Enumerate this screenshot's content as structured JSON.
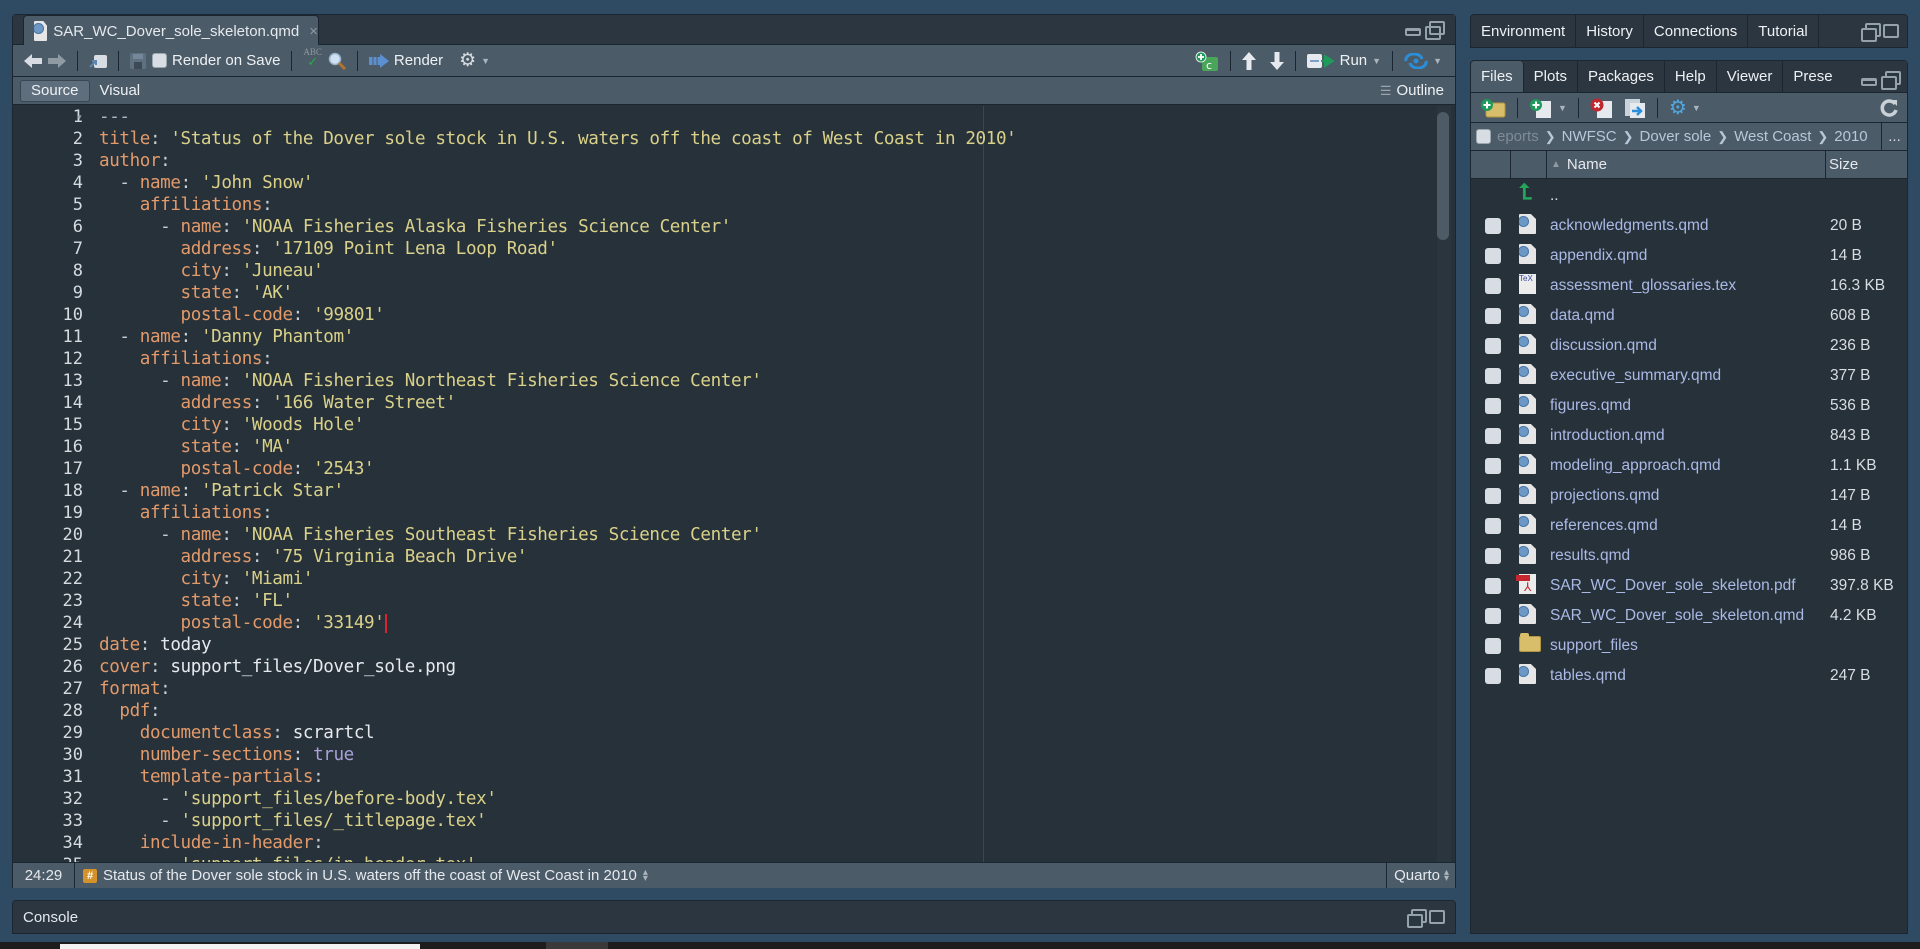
{
  "editor": {
    "tab": {
      "filename": "SAR_WC_Dover_sole_skeleton.qmd",
      "icon": "quarto-file-icon",
      "close": "×"
    },
    "toolbar": {
      "render_on_save_label": "Render on Save",
      "render_on_save_checked": false,
      "spellcheck_label": "ABC",
      "render_label": "Render",
      "run_label": "Run",
      "outline_label": "Outline"
    },
    "modes": {
      "source": "Source",
      "visual": "Visual",
      "active": "Source"
    },
    "code_lines": [
      [
        [
          "d",
          "---"
        ]
      ],
      [
        [
          "k",
          "title"
        ],
        [
          "p",
          ": "
        ],
        [
          "s",
          "'Status of the Dover sole stock in U.S. waters off the coast of West Coast in 2010'"
        ]
      ],
      [
        [
          "k",
          "author"
        ],
        [
          "p",
          ":"
        ]
      ],
      [
        [
          "p",
          "  - "
        ],
        [
          "k",
          "name"
        ],
        [
          "p",
          ": "
        ],
        [
          "s",
          "'John Snow'"
        ]
      ],
      [
        [
          "p",
          "    "
        ],
        [
          "k",
          "affiliations"
        ],
        [
          "p",
          ":"
        ]
      ],
      [
        [
          "p",
          "      - "
        ],
        [
          "k",
          "name"
        ],
        [
          "p",
          ": "
        ],
        [
          "s",
          "'NOAA Fisheries Alaska Fisheries Science Center'"
        ]
      ],
      [
        [
          "p",
          "        "
        ],
        [
          "k",
          "address"
        ],
        [
          "p",
          ": "
        ],
        [
          "s",
          "'17109 Point Lena Loop Road'"
        ]
      ],
      [
        [
          "p",
          "        "
        ],
        [
          "k",
          "city"
        ],
        [
          "p",
          ": "
        ],
        [
          "s",
          "'Juneau'"
        ]
      ],
      [
        [
          "p",
          "        "
        ],
        [
          "k",
          "state"
        ],
        [
          "p",
          ": "
        ],
        [
          "s",
          "'AK'"
        ]
      ],
      [
        [
          "p",
          "        "
        ],
        [
          "k",
          "postal-code"
        ],
        [
          "p",
          ": "
        ],
        [
          "s",
          "'99801'"
        ]
      ],
      [
        [
          "p",
          "  - "
        ],
        [
          "k",
          "name"
        ],
        [
          "p",
          ": "
        ],
        [
          "s",
          "'Danny Phantom'"
        ]
      ],
      [
        [
          "p",
          "    "
        ],
        [
          "k",
          "affiliations"
        ],
        [
          "p",
          ":"
        ]
      ],
      [
        [
          "p",
          "      - "
        ],
        [
          "k",
          "name"
        ],
        [
          "p",
          ": "
        ],
        [
          "s",
          "'NOAA Fisheries Northeast Fisheries Science Center'"
        ]
      ],
      [
        [
          "p",
          "        "
        ],
        [
          "k",
          "address"
        ],
        [
          "p",
          ": "
        ],
        [
          "s",
          "'166 Water Street'"
        ]
      ],
      [
        [
          "p",
          "        "
        ],
        [
          "k",
          "city"
        ],
        [
          "p",
          ": "
        ],
        [
          "s",
          "'Woods Hole'"
        ]
      ],
      [
        [
          "p",
          "        "
        ],
        [
          "k",
          "state"
        ],
        [
          "p",
          ": "
        ],
        [
          "s",
          "'MA'"
        ]
      ],
      [
        [
          "p",
          "        "
        ],
        [
          "k",
          "postal-code"
        ],
        [
          "p",
          ": "
        ],
        [
          "s",
          "'2543'"
        ]
      ],
      [
        [
          "p",
          "  - "
        ],
        [
          "k",
          "name"
        ],
        [
          "p",
          ": "
        ],
        [
          "s",
          "'Patrick Star'"
        ]
      ],
      [
        [
          "p",
          "    "
        ],
        [
          "k",
          "affiliations"
        ],
        [
          "p",
          ":"
        ]
      ],
      [
        [
          "p",
          "      - "
        ],
        [
          "k",
          "name"
        ],
        [
          "p",
          ": "
        ],
        [
          "s",
          "'NOAA Fisheries Southeast Fisheries Science Center'"
        ]
      ],
      [
        [
          "p",
          "        "
        ],
        [
          "k",
          "address"
        ],
        [
          "p",
          ": "
        ],
        [
          "s",
          "'75 Virginia Beach Drive'"
        ]
      ],
      [
        [
          "p",
          "        "
        ],
        [
          "k",
          "city"
        ],
        [
          "p",
          ": "
        ],
        [
          "s",
          "'Miami'"
        ]
      ],
      [
        [
          "p",
          "        "
        ],
        [
          "k",
          "state"
        ],
        [
          "p",
          ": "
        ],
        [
          "s",
          "'FL'"
        ]
      ],
      [
        [
          "p",
          "        "
        ],
        [
          "k",
          "postal-code"
        ],
        [
          "p",
          ": "
        ],
        [
          "s",
          "'33149'"
        ]
      ],
      [
        [
          "k",
          "date"
        ],
        [
          "p",
          ": "
        ],
        [
          "v",
          "today"
        ]
      ],
      [
        [
          "k",
          "cover"
        ],
        [
          "p",
          ": "
        ],
        [
          "v",
          "support_files/Dover_sole.png"
        ]
      ],
      [
        [
          "k",
          "format"
        ],
        [
          "p",
          ":"
        ]
      ],
      [
        [
          "p",
          "  "
        ],
        [
          "k",
          "pdf"
        ],
        [
          "p",
          ":"
        ]
      ],
      [
        [
          "p",
          "    "
        ],
        [
          "k",
          "documentclass"
        ],
        [
          "p",
          ": "
        ],
        [
          "v",
          "scrartcl"
        ]
      ],
      [
        [
          "p",
          "    "
        ],
        [
          "k",
          "number-sections"
        ],
        [
          "p",
          ": "
        ],
        [
          "b",
          "true"
        ]
      ],
      [
        [
          "p",
          "    "
        ],
        [
          "k",
          "template-partials"
        ],
        [
          "p",
          ":"
        ]
      ],
      [
        [
          "p",
          "      - "
        ],
        [
          "s",
          "'support_files/before-body.tex'"
        ]
      ],
      [
        [
          "p",
          "      - "
        ],
        [
          "s",
          "'support_files/_titlepage.tex'"
        ]
      ],
      [
        [
          "p",
          "    "
        ],
        [
          "k",
          "include-in-header"
        ],
        [
          "p",
          ":"
        ]
      ],
      [
        [
          "p",
          "      - "
        ],
        [
          "s",
          "'support_files/in-header.tex'"
        ]
      ]
    ],
    "cursor_line": 24,
    "status": {
      "position": "24:29",
      "section": "Status of the Dover sole stock in U.S. waters off the coast of West Coast in 2010",
      "language": "Quarto"
    }
  },
  "console": {
    "label": "Console"
  },
  "top_right_pane": {
    "tabs": [
      "Environment",
      "History",
      "Connections",
      "Tutorial"
    ]
  },
  "files_pane": {
    "tabs": [
      "Files",
      "Plots",
      "Packages",
      "Help",
      "Viewer",
      "Prese"
    ],
    "active_tab": "Files",
    "breadcrumb": [
      "eports",
      "NWFSC",
      "Dover sole",
      "West Coast",
      "2010"
    ],
    "breadcrumb_more": "...",
    "columns": {
      "name": "Name",
      "size": "Size"
    },
    "parent_dir": "..",
    "files": [
      {
        "name": "acknowledgments.qmd",
        "size": "20 B",
        "type": "qmd"
      },
      {
        "name": "appendix.qmd",
        "size": "14 B",
        "type": "qmd"
      },
      {
        "name": "assessment_glossaries.tex",
        "size": "16.3 KB",
        "type": "tex"
      },
      {
        "name": "data.qmd",
        "size": "608 B",
        "type": "qmd"
      },
      {
        "name": "discussion.qmd",
        "size": "236 B",
        "type": "qmd"
      },
      {
        "name": "executive_summary.qmd",
        "size": "377 B",
        "type": "qmd"
      },
      {
        "name": "figures.qmd",
        "size": "536 B",
        "type": "qmd"
      },
      {
        "name": "introduction.qmd",
        "size": "843 B",
        "type": "qmd"
      },
      {
        "name": "modeling_approach.qmd",
        "size": "1.1 KB",
        "type": "qmd"
      },
      {
        "name": "projections.qmd",
        "size": "147 B",
        "type": "qmd"
      },
      {
        "name": "references.qmd",
        "size": "14 B",
        "type": "qmd"
      },
      {
        "name": "results.qmd",
        "size": "986 B",
        "type": "qmd"
      },
      {
        "name": "SAR_WC_Dover_sole_skeleton.pdf",
        "size": "397.8 KB",
        "type": "pdf"
      },
      {
        "name": "SAR_WC_Dover_sole_skeleton.qmd",
        "size": "4.2 KB",
        "type": "qmd"
      },
      {
        "name": "support_files",
        "size": "",
        "type": "folder"
      },
      {
        "name": "tables.qmd",
        "size": "247 B",
        "type": "qmd"
      }
    ]
  }
}
